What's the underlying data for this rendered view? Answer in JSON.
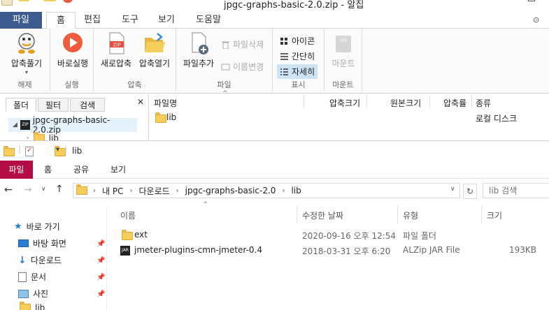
{
  "alzip": {
    "title": "jpgc-graphs-basic-2.0.zip - 알집",
    "tabs": [
      "파일",
      "홈",
      "편집",
      "도구",
      "보기",
      "도움말"
    ],
    "groups": [
      {
        "label": "해제",
        "buttons": [
          "압축풀기"
        ]
      },
      {
        "label": "실행",
        "buttons": [
          "바로실행"
        ]
      },
      {
        "label": "압축",
        "buttons": [
          "새로압축",
          "압축열기"
        ]
      },
      {
        "label": "파일",
        "buttons": [
          "파일추가"
        ],
        "small": [
          "파일삭제",
          "이름변경"
        ]
      },
      {
        "label": "표시",
        "small": [
          "아이콘",
          "간단히",
          "자세히"
        ]
      },
      {
        "label": "마운트",
        "buttons": [
          "마운트"
        ]
      }
    ],
    "pane_tabs": [
      "폴더",
      "필터",
      "검색"
    ],
    "tree": {
      "root": "jpgc-graphs-basic-2.0.zip",
      "child": "lib"
    },
    "columns": [
      "파일명",
      "압축크기",
      "원본크기",
      "압축률",
      "종류"
    ],
    "rows": [
      {
        "name": "lib",
        "type": "로컬 디스크"
      }
    ]
  },
  "explorer": {
    "title": "lib",
    "tabs": [
      "파일",
      "홈",
      "공유",
      "보기"
    ],
    "breadcrumb": [
      "내 PC",
      "다운로드",
      "jpgc-graphs-basic-2.0",
      "lib"
    ],
    "search_placeholder": "lib 검색",
    "nav": [
      {
        "label": "바로 가기",
        "icon": "star-icon"
      },
      {
        "label": "바탕 화면",
        "icon": "desktop-icon",
        "pinned": true
      },
      {
        "label": "다운로드",
        "icon": "download-icon",
        "pinned": true
      },
      {
        "label": "문서",
        "icon": "document-icon",
        "pinned": true
      },
      {
        "label": "사진",
        "icon": "picture-icon",
        "pinned": true
      },
      {
        "label": "lib",
        "icon": "folder-icon"
      }
    ],
    "columns": [
      "이름",
      "수정한 날짜",
      "유형",
      "크기"
    ],
    "rows": [
      {
        "name": "ext",
        "date": "2020-09-16 오후 12:54",
        "type": "파일 폴더",
        "size": ""
      },
      {
        "name": "jmeter-plugins-cmn-jmeter-0.4",
        "date": "2018-03-31 오후 6:20",
        "type": "ALZip JAR File",
        "size": "193KB"
      }
    ]
  },
  "colors": {
    "alzip_file_tab": "#3c5b8e",
    "explorer_file_tab": "#b20d45",
    "folder": "#f6cd5b"
  }
}
